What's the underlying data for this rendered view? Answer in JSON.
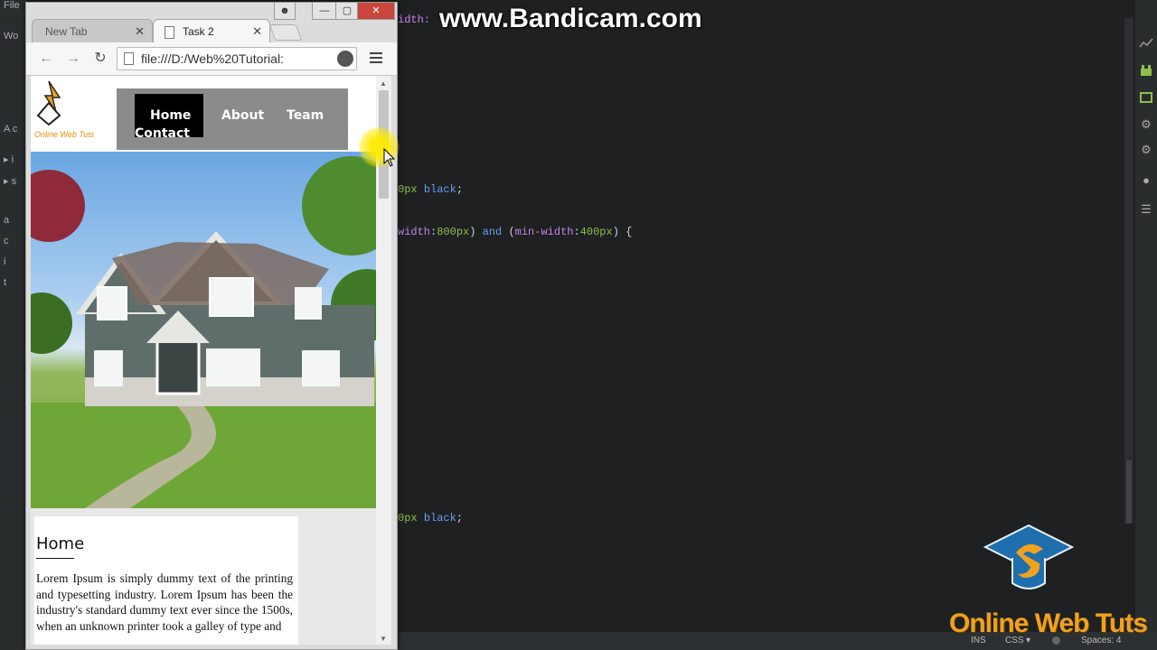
{
  "watermark": "www.Bandicam.com",
  "brand": {
    "name": "Online Web Tuts"
  },
  "editor": {
    "left_panel_letters": [
      "File",
      "Wo",
      "A c",
      "▸ i",
      "▸ s",
      "a",
      "c",
      "i",
      "t"
    ],
    "code_lines": [
      {
        "text": "idth:",
        "style": "prop"
      },
      {
        "text": "0px black;",
        "style": "value"
      },
      {
        "text": "width:800px) and (min-width:400px) {",
        "style": "media"
      },
      {
        "text": "0px black;",
        "style": "value"
      }
    ],
    "status": {
      "ins": "INS",
      "lang": "CSS",
      "spaces": "Spaces: 4"
    }
  },
  "browser": {
    "tabs": [
      {
        "label": "New Tab",
        "active": false
      },
      {
        "label": "Task 2",
        "active": true
      }
    ],
    "address": "file:///D:/Web%20Tutorial:",
    "nav_icons": [
      "back-icon",
      "forward-icon",
      "reload-icon",
      "star-icon",
      "extension-icon",
      "menu-icon"
    ]
  },
  "site": {
    "logo_text": "Online Web Tuts",
    "nav": [
      {
        "label": "Home",
        "active": true
      },
      {
        "label": "About",
        "active": false
      },
      {
        "label": "Team",
        "active": false
      },
      {
        "label": "Contact",
        "active": false
      }
    ],
    "content": {
      "heading": "Home",
      "paragraph": "Lorem Ipsum is simply dummy text of the printing and typesetting industry. Lorem Ipsum has been the industry's standard dummy text ever since the 1500s, when an unknown printer took a galley of type and"
    }
  },
  "colors": {
    "editor_bg": "#1e2022",
    "nav_bg": "#8b8b8b",
    "nav_active_bg": "#000000",
    "brand_orange": "#f0a11e",
    "code_number": "#8fbf4a",
    "code_keyword": "#6c9ef8",
    "code_property": "#c882e8"
  }
}
